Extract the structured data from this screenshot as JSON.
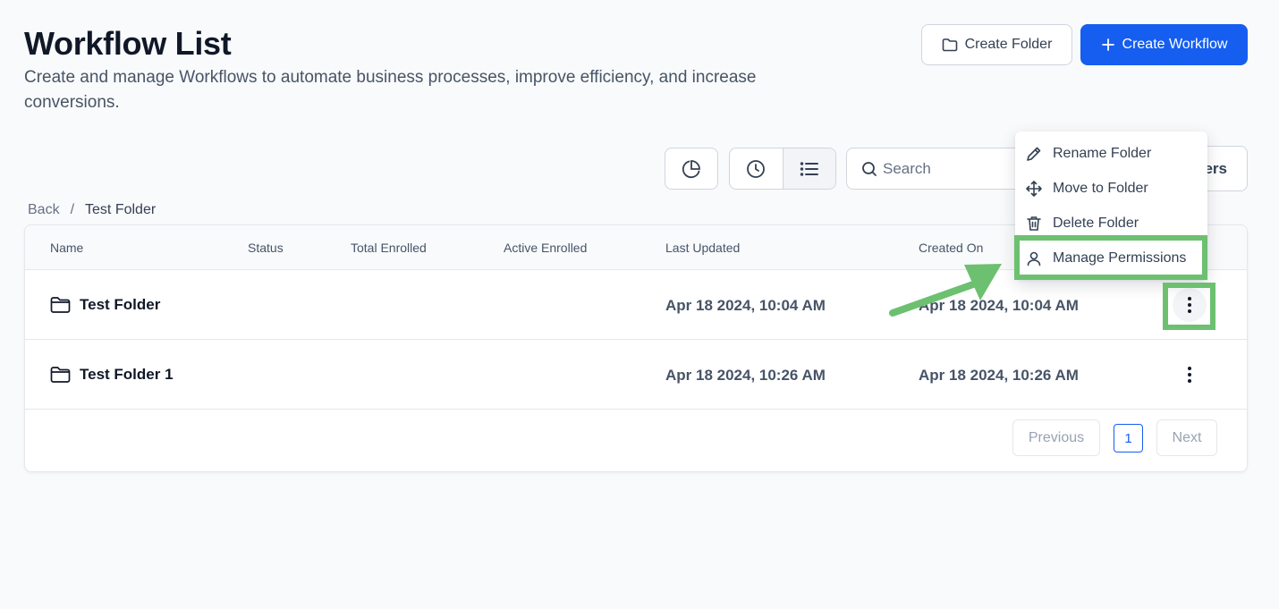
{
  "header": {
    "title": "Workflow List",
    "subtitle": "Create and manage Workflows to automate business processes, improve efficiency, and increase conversions.",
    "create_folder_label": "Create Folder",
    "create_workflow_label": "Create Workflow"
  },
  "toolbar": {
    "search_placeholder": "Search",
    "filters_label": "ers"
  },
  "breadcrumb": {
    "back": "Back",
    "separator": "/",
    "current": "Test Folder"
  },
  "table": {
    "columns": [
      "Name",
      "Status",
      "Total Enrolled",
      "Active Enrolled",
      "Last Updated",
      "Created On"
    ],
    "rows": [
      {
        "name": "Test Folder",
        "last_updated": "Apr 18 2024, 10:04 AM",
        "created_on": "Apr 18 2024, 10:04 AM"
      },
      {
        "name": "Test Folder 1",
        "last_updated": "Apr 18 2024, 10:26 AM",
        "created_on": "Apr 18 2024, 10:26 AM"
      }
    ]
  },
  "pagination": {
    "previous": "Previous",
    "page": "1",
    "next": "Next"
  },
  "menu": {
    "items": [
      {
        "label": "Rename Folder",
        "icon": "pencil-icon"
      },
      {
        "label": "Move to Folder",
        "icon": "move-icon"
      },
      {
        "label": "Delete Folder",
        "icon": "trash-icon"
      },
      {
        "label": "Manage Permissions",
        "icon": "user-icon"
      }
    ]
  },
  "colors": {
    "primary": "#155eef",
    "annotation_green": "#6cc070"
  }
}
